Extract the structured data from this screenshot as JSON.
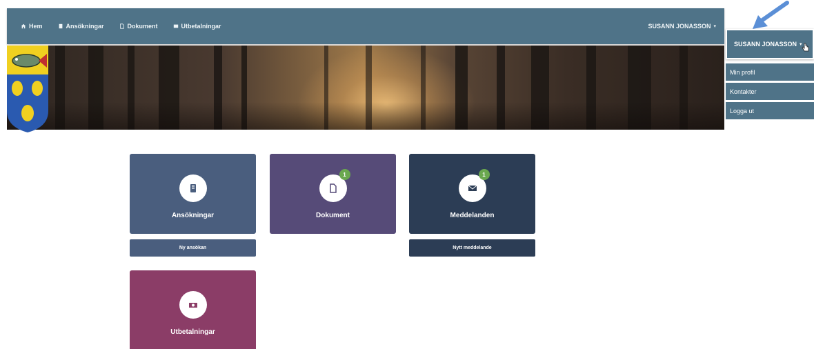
{
  "colors": {
    "navbar": "#4f7388",
    "tile_ansokningar": "#4a5e7e",
    "tile_dokument": "#564b78",
    "tile_meddelanden": "#2c3d55",
    "tile_utbetalningar": "#8b3d67",
    "badge": "#6aa84f",
    "pointer_arrow": "#5b8fd6"
  },
  "navbar": {
    "items": [
      {
        "label": "Hem",
        "icon": "home-icon"
      },
      {
        "label": "Ansökningar",
        "icon": "file-icon"
      },
      {
        "label": "Dokument",
        "icon": "document-icon"
      },
      {
        "label": "Utbetalningar",
        "icon": "payment-icon"
      }
    ],
    "user_label": "SUSANN JONASSON",
    "user_caret": "▾"
  },
  "dropdown": {
    "header_label": "SUSANN JONASSON",
    "caret": "▾",
    "items": [
      "Min profil",
      "Kontakter",
      "Logga ut"
    ]
  },
  "tiles": [
    {
      "label": "Ansökningar",
      "icon": "application-icon",
      "badge": null,
      "button": "Ny ansökan"
    },
    {
      "label": "Dokument",
      "icon": "document-icon",
      "badge": "1",
      "button": null
    },
    {
      "label": "Meddelanden",
      "icon": "envelope-icon",
      "badge": "1",
      "button": "Nytt meddelande"
    },
    {
      "label": "Utbetalningar",
      "icon": "money-icon",
      "badge": null,
      "button": null
    }
  ]
}
